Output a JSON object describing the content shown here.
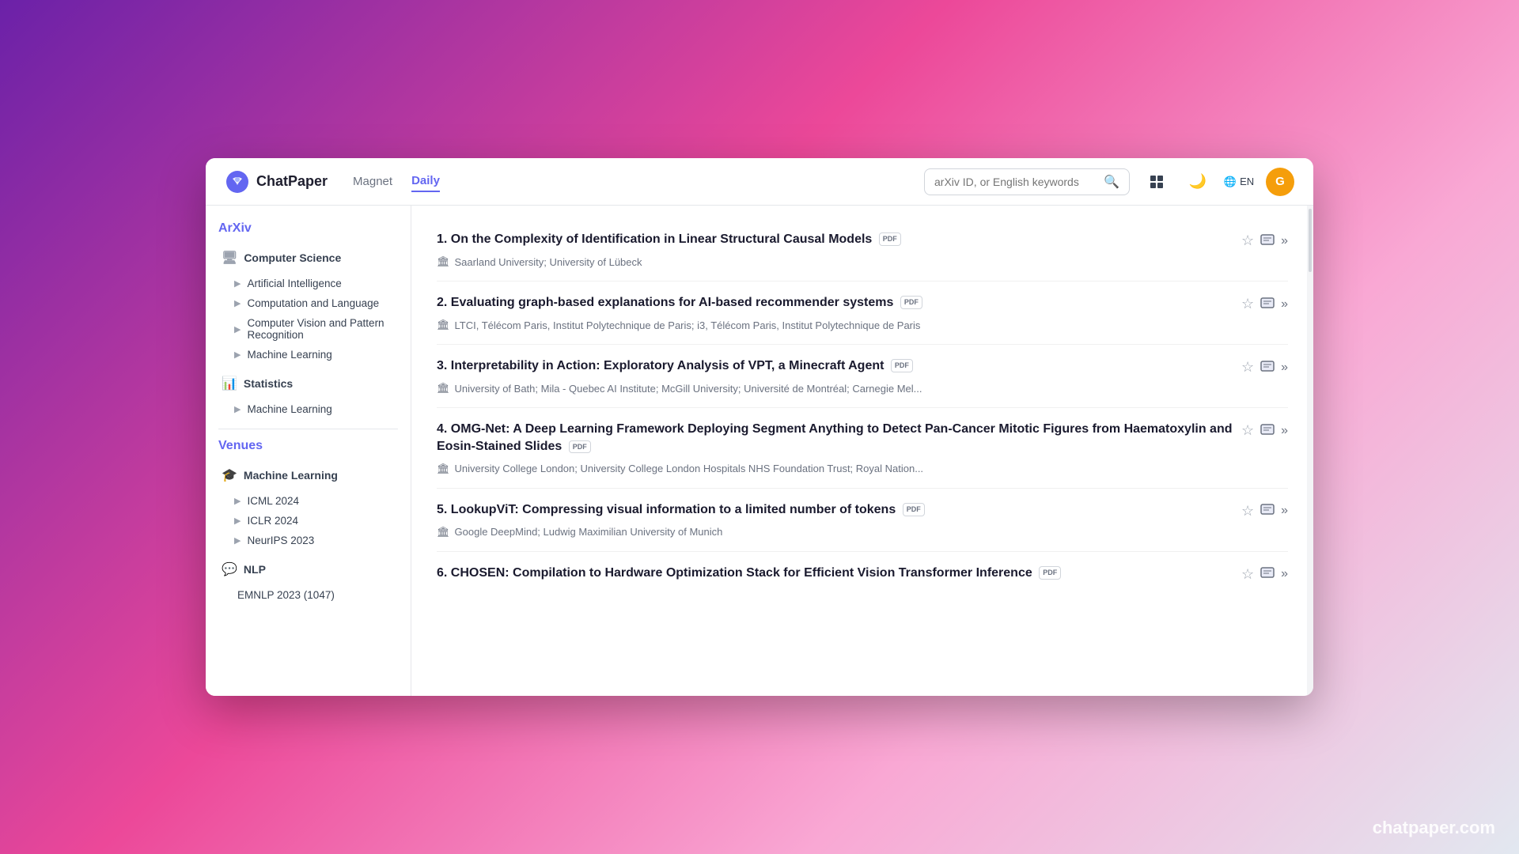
{
  "app": {
    "name": "ChatPaper",
    "tagline": "chatpaper.com"
  },
  "header": {
    "nav": [
      {
        "label": "Magnet",
        "active": false
      },
      {
        "label": "Daily",
        "active": true
      }
    ],
    "search_placeholder": "arXiv ID, or English keywords",
    "lang": "EN"
  },
  "sidebar": {
    "sections": [
      {
        "title": "ArXiv",
        "categories": [
          {
            "icon": "🖥",
            "label": "Computer Science",
            "items": [
              {
                "label": "Artificial Intelligence"
              },
              {
                "label": "Computation and Language"
              },
              {
                "label": "Computer Vision and Pattern Recognition"
              },
              {
                "label": "Machine Learning"
              }
            ]
          },
          {
            "icon": "📊",
            "label": "Statistics",
            "items": [
              {
                "label": "Machine Learning"
              }
            ]
          }
        ]
      },
      {
        "title": "Venues",
        "categories": [
          {
            "icon": "🎓",
            "label": "Machine Learning",
            "items": [
              {
                "label": "ICML 2024"
              },
              {
                "label": "ICLR 2024"
              },
              {
                "label": "NeurIPS 2023"
              }
            ]
          },
          {
            "icon": "💬",
            "label": "NLP",
            "items": [
              {
                "label": "EMNLP 2023 (1047)"
              }
            ]
          }
        ]
      }
    ]
  },
  "papers": [
    {
      "number": "1.",
      "title": "On the Complexity of Identification in Linear Structural Causal Models",
      "has_pdf": true,
      "institution": "Saarland University; University of Lübeck"
    },
    {
      "number": "2.",
      "title": "Evaluating graph-based explanations for AI-based recommender systems",
      "has_pdf": true,
      "institution": "LTCI, Télécom Paris, Institut Polytechnique de Paris; i3, Télécom Paris, Institut Polytechnique de Paris"
    },
    {
      "number": "3.",
      "title": "Interpretability in Action: Exploratory Analysis of VPT, a Minecraft Agent",
      "has_pdf": true,
      "institution": "University of Bath; Mila - Quebec AI Institute; McGill University; Université de Montréal; Carnegie Mel..."
    },
    {
      "number": "4.",
      "title": "OMG-Net: A Deep Learning Framework Deploying Segment Anything to Detect Pan-Cancer Mitotic Figures from Haematoxylin and Eosin-Stained Slides",
      "has_pdf": true,
      "institution": "University College London; University College London Hospitals NHS Foundation Trust; Royal Nation..."
    },
    {
      "number": "5.",
      "title": "LookupViT: Compressing visual information to a limited number of tokens",
      "has_pdf": true,
      "institution": "Google DeepMind; Ludwig Maximilian University of Munich"
    },
    {
      "number": "6.",
      "title": "CHOSEN: Compilation to Hardware Optimization Stack for Efficient Vision Transformer Inference",
      "has_pdf": true,
      "institution": ""
    }
  ],
  "icons": {
    "star": "☆",
    "star_filled": "★",
    "chat": "💬",
    "expand": "»",
    "search": "🔍",
    "moon": "🌙",
    "globe": "🌐",
    "grid": "⊞",
    "institution": "🏛",
    "pdf_label": "PDF"
  }
}
